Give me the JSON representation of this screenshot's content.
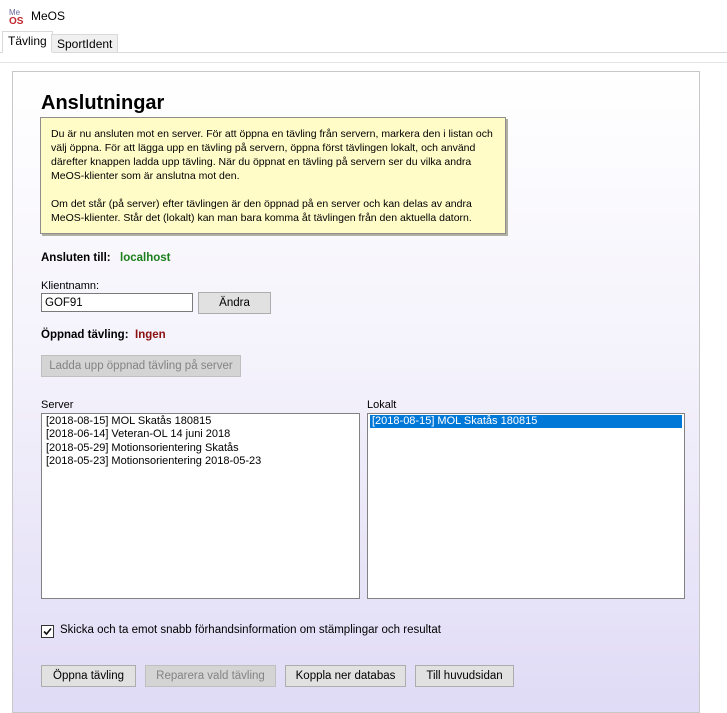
{
  "window": {
    "title": "MeOS",
    "icon": "meos-app-icon"
  },
  "tabs": [
    {
      "label": "Tävling",
      "active": true
    },
    {
      "label": "SportIdent",
      "active": false
    }
  ],
  "page": {
    "heading": "Anslutningar",
    "info_paragraph_1": "Du är nu ansluten mot en server. För att öppna en tävling från servern, markera den i listan och välj öppna. För att lägga upp en tävling på servern, öppna först tävlingen lokalt, och använd därefter knappen ladda upp tävling. När du öppnat en tävling på servern ser du vilka andra MeOS-klienter som är anslutna mot den.",
    "info_paragraph_2": "Om det står (på server) efter tävlingen är den öppnad på en server och kan delas av andra MeOS-klienter. Står det (lokalt) kan man bara komma åt tävlingen från den aktuella datorn.",
    "connected_label": "Ansluten till:",
    "connected_value": "localhost",
    "client_name_label": "Klientnamn:",
    "client_name_value": "GOF91",
    "change_button": "Ändra",
    "opened_comp_label": "Öppnad tävling:",
    "opened_comp_value": "Ingen",
    "upload_button": "Ladda upp öppnad tävling på server",
    "server_label": "Server",
    "server_items": [
      "[2018-08-15] MOL Skatås 180815",
      "[2018-06-14] Veteran-OL 14 juni 2018",
      "[2018-05-29] Motionsorientering Skatås",
      "[2018-05-23] Motionsorientering 2018-05-23"
    ],
    "local_label": "Lokalt",
    "local_items": [
      "[2018-08-15] MOL Skatås 180815"
    ],
    "local_selected_index": 0,
    "checkbox_label": "Skicka och ta emot snabb förhandsinformation om stämplingar och resultat",
    "checkbox_checked": true,
    "buttons": {
      "open": "Öppna tävling",
      "repair": "Reparera vald tävling",
      "disconnect": "Koppla ner databas",
      "main": "Till huvudsidan"
    }
  },
  "colors": {
    "info_bg": "#fffcc8",
    "connected": "#1b7f1b",
    "opened": "#8b1010",
    "selection": "#0078d7"
  }
}
